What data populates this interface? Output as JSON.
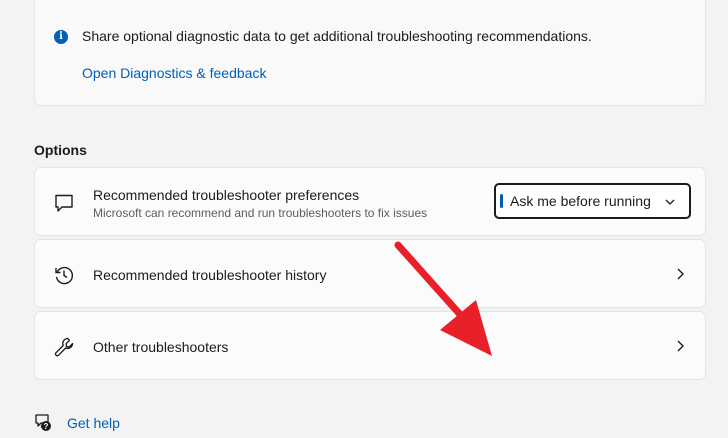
{
  "diagnostics": {
    "message": "Share optional diagnostic data to get additional troubleshooting recommendations.",
    "link": "Open Diagnostics & feedback"
  },
  "options": {
    "heading": "Options",
    "preferences": {
      "title": "Recommended troubleshooter preferences",
      "subtitle": "Microsoft can recommend and run troubleshooters to fix issues",
      "dropdown_value": "Ask me before running"
    },
    "history": {
      "title": "Recommended troubleshooter history"
    },
    "other": {
      "title": "Other troubleshooters"
    }
  },
  "help": {
    "link": "Get help"
  },
  "colors": {
    "accent": "#005fb8",
    "annotation_arrow": "#e8202a"
  },
  "icons": [
    "info-icon",
    "chat-icon",
    "history-icon",
    "wrench-icon",
    "chevron-right-icon",
    "chevron-down-icon",
    "help-icon"
  ]
}
